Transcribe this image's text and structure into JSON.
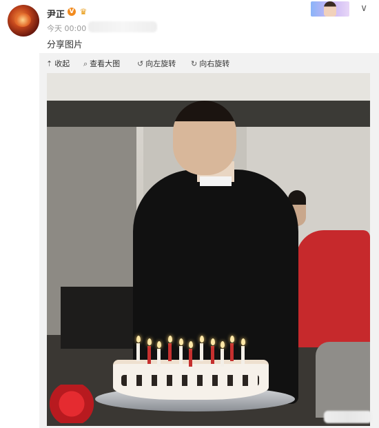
{
  "post": {
    "username": "尹正",
    "verified_icon": "verified-v-icon",
    "member_icon": "crown-icon",
    "timestamp": "今天 00:00",
    "text": "分享图片"
  },
  "header": {
    "follow_avatar_icon": "user-avatar-thumbnail",
    "menu_icon": "chevron-down-icon"
  },
  "toolbar": {
    "collapse": "收起",
    "view_large": "查看大图",
    "rotate_left": "向左旋转",
    "rotate_right": "向右旋转",
    "icons": {
      "collapse": "arrow-up-icon",
      "view_large": "magnifier-icon",
      "rotate_left": "rotate-left-icon",
      "rotate_right": "rotate-right-icon"
    }
  },
  "photo": {
    "description_icon": "birthday-photo"
  },
  "colors": {
    "accent_orange": "#f28b1f",
    "panel_bg": "#f2f2f2",
    "text": "#333333",
    "muted": "#999999"
  }
}
